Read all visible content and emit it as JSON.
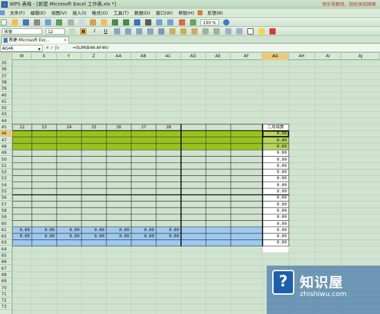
{
  "window": {
    "title": "WPS 表格 - [新建 Microsoft Excel 工作表.xls *]",
    "promo_text": "快乐哥教程，轻松体验网络"
  },
  "menu": {
    "items": [
      "文件(F)",
      "编辑(E)",
      "视图(V)",
      "插入(I)",
      "格式(O)",
      "工具(T)",
      "数据(D)",
      "窗口(W)",
      "帮助(H)",
      "反馈(B)"
    ]
  },
  "format_toolbar": {
    "font_name": "宋体",
    "font_size": "12",
    "bold": "B",
    "italic": "I",
    "underline": "U"
  },
  "standard_toolbar": {
    "zoom": "100 %"
  },
  "document_tab": {
    "label": "新建 Microsoft Exc...",
    "close": "×"
  },
  "formula_bar": {
    "name_box": "AG46",
    "formula": "=SUM(B46:AF46)"
  },
  "columns": [
    "W",
    "X",
    "Y",
    "Z",
    "AA",
    "AB",
    "AC",
    "AD",
    "AE",
    "AF",
    "AG",
    "AH",
    "AI",
    "AJ"
  ],
  "selected_column": "AG",
  "rows": [
    "35",
    "36",
    "37",
    "38",
    "39",
    "40",
    "41",
    "42",
    "43",
    "44",
    "45",
    "46",
    "47",
    "48",
    "49",
    "50",
    "51",
    "52",
    "53",
    "54",
    "55",
    "56",
    "57",
    "58",
    "59",
    "60",
    "61",
    "62",
    "63",
    "64",
    "65",
    "66",
    "67",
    "68",
    "69",
    "70",
    "71",
    "72",
    "73"
  ],
  "selected_row": "46",
  "day_headers": [
    "22",
    "23",
    "24",
    "25",
    "26",
    "27",
    "28"
  ],
  "summary_header": "二月结算",
  "ag_values": [
    "0.00",
    "0.00",
    "0.00",
    "0.00",
    "0.00",
    "0.00",
    "0.00",
    "0.00",
    "0.00",
    "0.00",
    "0.00",
    "0.00",
    "0.00",
    "0.00",
    "0.00",
    "0.00",
    "0.00",
    "0.00"
  ],
  "blue_row_61": [
    "0.00",
    "0.00",
    "0.00",
    "0.00",
    "0.00",
    "0.00",
    "0.00"
  ],
  "blue_row_62": [
    "0.00",
    "0.00",
    "0.00",
    "0.00",
    "0.00",
    "0.00",
    "0.00"
  ],
  "colors": {
    "green_band": "#99c31a",
    "blue_band": "#9dc9f0",
    "selection": "#f0c87a"
  },
  "watermark": {
    "title": "知识屋",
    "url": "zhishiwu.com"
  }
}
